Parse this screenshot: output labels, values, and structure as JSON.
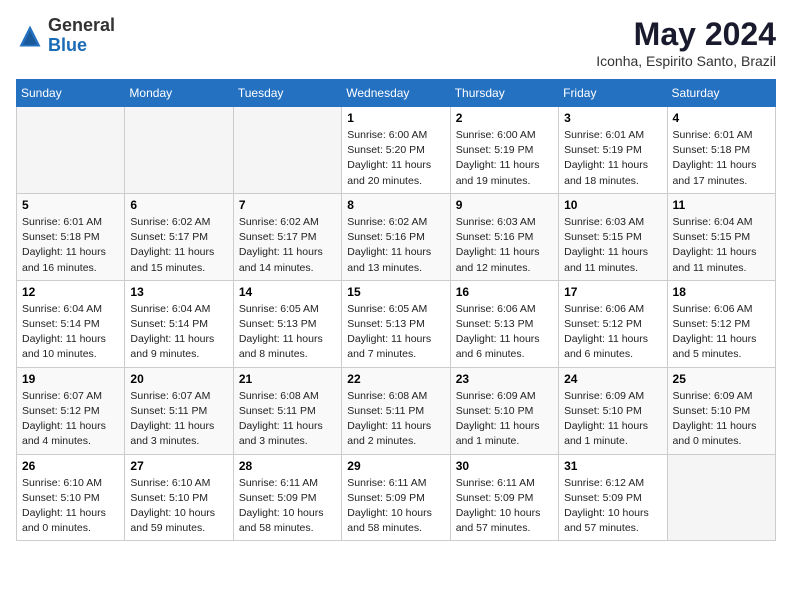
{
  "header": {
    "logo_general": "General",
    "logo_blue": "Blue",
    "month_year": "May 2024",
    "location": "Iconha, Espirito Santo, Brazil"
  },
  "days_of_week": [
    "Sunday",
    "Monday",
    "Tuesday",
    "Wednesday",
    "Thursday",
    "Friday",
    "Saturday"
  ],
  "weeks": [
    [
      {
        "day": "",
        "info": ""
      },
      {
        "day": "",
        "info": ""
      },
      {
        "day": "",
        "info": ""
      },
      {
        "day": "1",
        "info": "Sunrise: 6:00 AM\nSunset: 5:20 PM\nDaylight: 11 hours and 20 minutes."
      },
      {
        "day": "2",
        "info": "Sunrise: 6:00 AM\nSunset: 5:19 PM\nDaylight: 11 hours and 19 minutes."
      },
      {
        "day": "3",
        "info": "Sunrise: 6:01 AM\nSunset: 5:19 PM\nDaylight: 11 hours and 18 minutes."
      },
      {
        "day": "4",
        "info": "Sunrise: 6:01 AM\nSunset: 5:18 PM\nDaylight: 11 hours and 17 minutes."
      }
    ],
    [
      {
        "day": "5",
        "info": "Sunrise: 6:01 AM\nSunset: 5:18 PM\nDaylight: 11 hours and 16 minutes."
      },
      {
        "day": "6",
        "info": "Sunrise: 6:02 AM\nSunset: 5:17 PM\nDaylight: 11 hours and 15 minutes."
      },
      {
        "day": "7",
        "info": "Sunrise: 6:02 AM\nSunset: 5:17 PM\nDaylight: 11 hours and 14 minutes."
      },
      {
        "day": "8",
        "info": "Sunrise: 6:02 AM\nSunset: 5:16 PM\nDaylight: 11 hours and 13 minutes."
      },
      {
        "day": "9",
        "info": "Sunrise: 6:03 AM\nSunset: 5:16 PM\nDaylight: 11 hours and 12 minutes."
      },
      {
        "day": "10",
        "info": "Sunrise: 6:03 AM\nSunset: 5:15 PM\nDaylight: 11 hours and 11 minutes."
      },
      {
        "day": "11",
        "info": "Sunrise: 6:04 AM\nSunset: 5:15 PM\nDaylight: 11 hours and 11 minutes."
      }
    ],
    [
      {
        "day": "12",
        "info": "Sunrise: 6:04 AM\nSunset: 5:14 PM\nDaylight: 11 hours and 10 minutes."
      },
      {
        "day": "13",
        "info": "Sunrise: 6:04 AM\nSunset: 5:14 PM\nDaylight: 11 hours and 9 minutes."
      },
      {
        "day": "14",
        "info": "Sunrise: 6:05 AM\nSunset: 5:13 PM\nDaylight: 11 hours and 8 minutes."
      },
      {
        "day": "15",
        "info": "Sunrise: 6:05 AM\nSunset: 5:13 PM\nDaylight: 11 hours and 7 minutes."
      },
      {
        "day": "16",
        "info": "Sunrise: 6:06 AM\nSunset: 5:13 PM\nDaylight: 11 hours and 6 minutes."
      },
      {
        "day": "17",
        "info": "Sunrise: 6:06 AM\nSunset: 5:12 PM\nDaylight: 11 hours and 6 minutes."
      },
      {
        "day": "18",
        "info": "Sunrise: 6:06 AM\nSunset: 5:12 PM\nDaylight: 11 hours and 5 minutes."
      }
    ],
    [
      {
        "day": "19",
        "info": "Sunrise: 6:07 AM\nSunset: 5:12 PM\nDaylight: 11 hours and 4 minutes."
      },
      {
        "day": "20",
        "info": "Sunrise: 6:07 AM\nSunset: 5:11 PM\nDaylight: 11 hours and 3 minutes."
      },
      {
        "day": "21",
        "info": "Sunrise: 6:08 AM\nSunset: 5:11 PM\nDaylight: 11 hours and 3 minutes."
      },
      {
        "day": "22",
        "info": "Sunrise: 6:08 AM\nSunset: 5:11 PM\nDaylight: 11 hours and 2 minutes."
      },
      {
        "day": "23",
        "info": "Sunrise: 6:09 AM\nSunset: 5:10 PM\nDaylight: 11 hours and 1 minute."
      },
      {
        "day": "24",
        "info": "Sunrise: 6:09 AM\nSunset: 5:10 PM\nDaylight: 11 hours and 1 minute."
      },
      {
        "day": "25",
        "info": "Sunrise: 6:09 AM\nSunset: 5:10 PM\nDaylight: 11 hours and 0 minutes."
      }
    ],
    [
      {
        "day": "26",
        "info": "Sunrise: 6:10 AM\nSunset: 5:10 PM\nDaylight: 11 hours and 0 minutes."
      },
      {
        "day": "27",
        "info": "Sunrise: 6:10 AM\nSunset: 5:10 PM\nDaylight: 10 hours and 59 minutes."
      },
      {
        "day": "28",
        "info": "Sunrise: 6:11 AM\nSunset: 5:09 PM\nDaylight: 10 hours and 58 minutes."
      },
      {
        "day": "29",
        "info": "Sunrise: 6:11 AM\nSunset: 5:09 PM\nDaylight: 10 hours and 58 minutes."
      },
      {
        "day": "30",
        "info": "Sunrise: 6:11 AM\nSunset: 5:09 PM\nDaylight: 10 hours and 57 minutes."
      },
      {
        "day": "31",
        "info": "Sunrise: 6:12 AM\nSunset: 5:09 PM\nDaylight: 10 hours and 57 minutes."
      },
      {
        "day": "",
        "info": ""
      }
    ]
  ]
}
